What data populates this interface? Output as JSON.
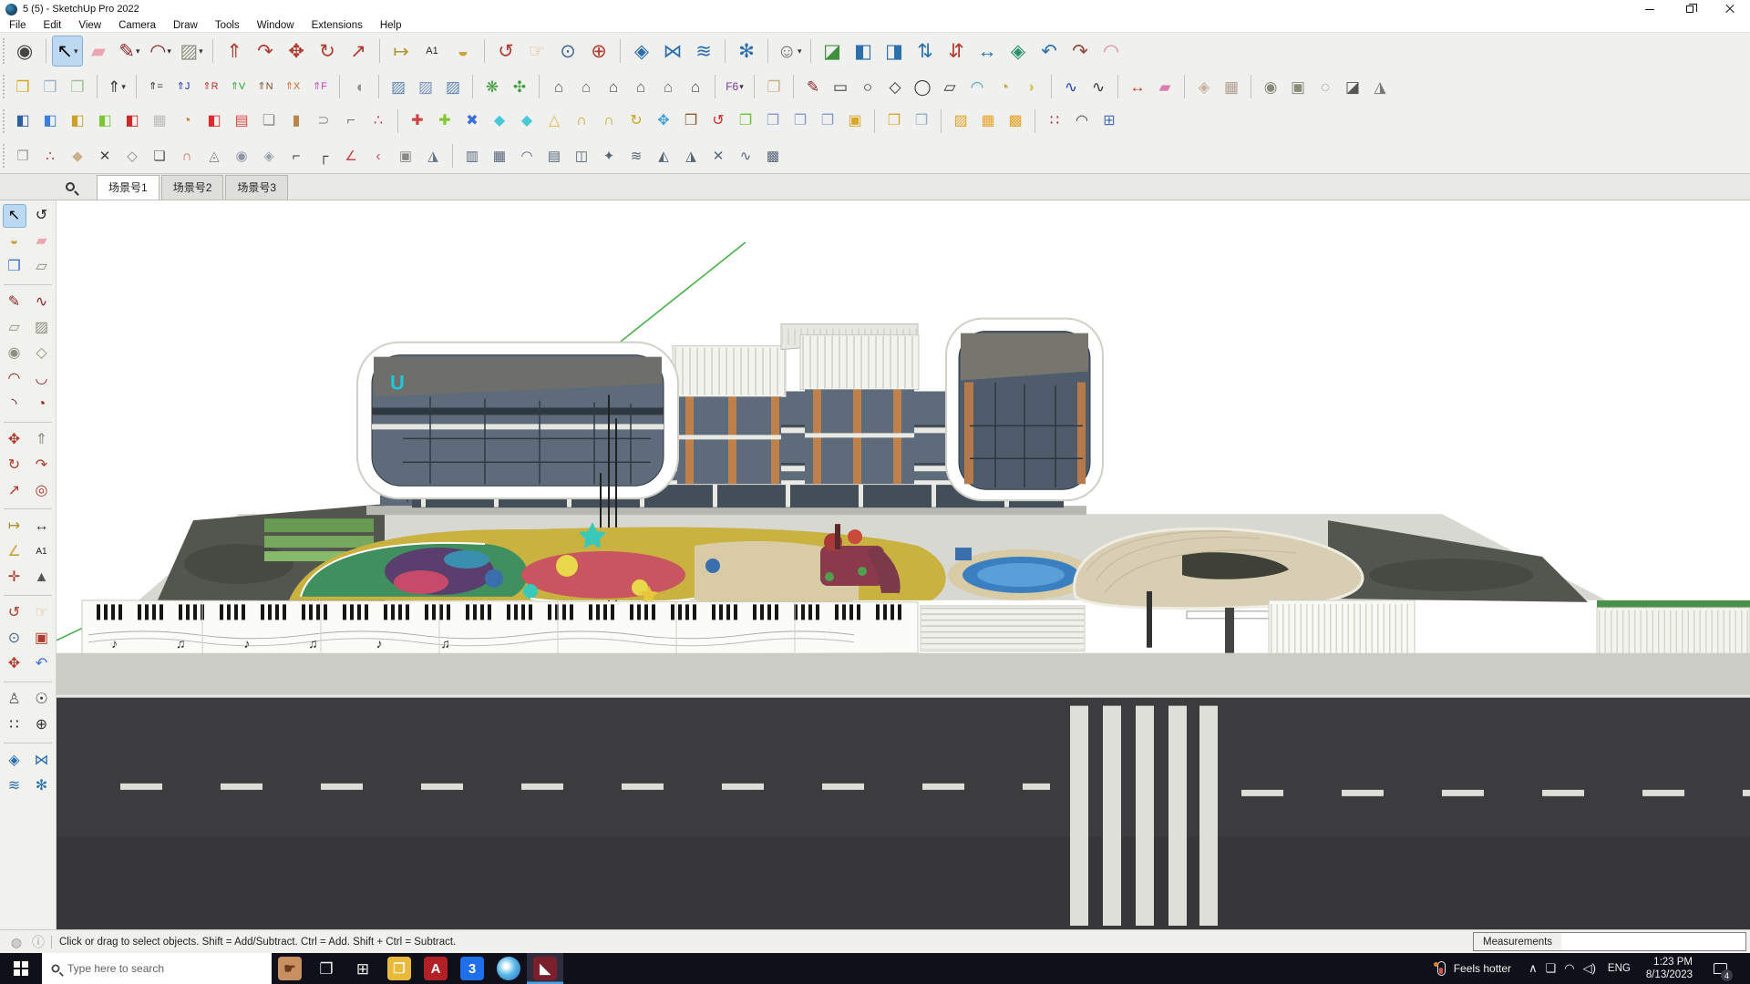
{
  "window": {
    "title": "5 (5) - SketchUp Pro 2022"
  },
  "menu": {
    "items": [
      "File",
      "Edit",
      "View",
      "Camera",
      "Draw",
      "Tools",
      "Window",
      "Extensions",
      "Help"
    ]
  },
  "toolbar_row1": [
    {
      "n": "zoom-selection",
      "g": "◉",
      "c": "#444"
    },
    {
      "sep": true
    },
    {
      "n": "select",
      "g": "↖",
      "c": "#000",
      "active": true,
      "dd": true
    },
    {
      "n": "eraser",
      "g": "▰",
      "c": "#eba6b1"
    },
    {
      "n": "line",
      "g": "✎",
      "c": "#8d2323",
      "dd": true
    },
    {
      "n": "arc",
      "g": "◠",
      "c": "#8d2323",
      "dd": true
    },
    {
      "n": "rectangle",
      "g": "▨",
      "c": "#8f8f7f",
      "dd": true
    },
    {
      "sep": true
    },
    {
      "n": "push-pull",
      "g": "⇑",
      "c": "#b03a2e"
    },
    {
      "n": "follow-me",
      "g": "↷",
      "c": "#b03a2e"
    },
    {
      "n": "move",
      "g": "✥",
      "c": "#b03a2e"
    },
    {
      "n": "rotate",
      "g": "↻",
      "c": "#b03a2e"
    },
    {
      "n": "scale",
      "g": "↗",
      "c": "#b03a2e"
    },
    {
      "sep": true
    },
    {
      "n": "tape-measure",
      "g": "↦",
      "c": "#b0952f"
    },
    {
      "n": "text",
      "g": "A1",
      "c": "#222",
      "fs": 11
    },
    {
      "n": "paint-bucket",
      "g": "◒",
      "c": "#caa23f"
    },
    {
      "sep": true
    },
    {
      "n": "orbit",
      "g": "↺",
      "c": "#b03a2e"
    },
    {
      "n": "pan",
      "g": "☞",
      "c": "#d9b98b"
    },
    {
      "n": "zoom",
      "g": "⊙",
      "c": "#46688e"
    },
    {
      "n": "zoom-extents",
      "g": "⊕",
      "c": "#b03a2e"
    },
    {
      "sep": true
    },
    {
      "n": "solid-inspect",
      "g": "◈",
      "c": "#2c6fad"
    },
    {
      "n": "mirror",
      "g": "⋈",
      "c": "#2c6fad"
    },
    {
      "n": "stack-layers",
      "g": "≋",
      "c": "#2c6fad"
    },
    {
      "sep": true
    },
    {
      "n": "mirror-settings",
      "g": "✻",
      "c": "#2c6fad"
    },
    {
      "sep": true
    },
    {
      "n": "account",
      "g": "☺",
      "c": "#666",
      "dd": true
    },
    {
      "sep": true
    },
    {
      "n": "drop-to-face",
      "g": "◪",
      "c": "#3f8f3f"
    },
    {
      "n": "flatten-face",
      "g": "◧",
      "c": "#2c6fad"
    },
    {
      "n": "split-face",
      "g": "◨",
      "c": "#2c6fad"
    },
    {
      "n": "move-up-down",
      "g": "⇅",
      "c": "#2c6fad"
    },
    {
      "n": "move-down-up",
      "g": "⇵",
      "c": "#b03a2e"
    },
    {
      "n": "stretch-diagonal",
      "g": "↔",
      "c": "#2c6fad"
    },
    {
      "n": "flip-face",
      "g": "◈",
      "c": "#2c8f6f"
    },
    {
      "n": "bend-back",
      "g": "↶",
      "c": "#2c6fad"
    },
    {
      "n": "bend-forward",
      "g": "↷",
      "c": "#8d4a3a"
    },
    {
      "n": "round-corner",
      "g": "◠",
      "c": "#d98ba0"
    }
  ],
  "toolbar_row2": [
    {
      "n": "solid-union",
      "g": "❒",
      "c": "#d9a827"
    },
    {
      "n": "solid-subtract",
      "g": "❒",
      "c": "#9fb4cc"
    },
    {
      "n": "solid-intersect",
      "g": "❒",
      "c": "#9fc49a"
    },
    {
      "sep": true
    },
    {
      "n": "joint-push-pull-main",
      "g": "⇑",
      "c": "#333",
      "dd": true
    },
    {
      "sep": true
    },
    {
      "n": "jpp-equal",
      "g": "⇑=",
      "c": "#222",
      "fs": 11
    },
    {
      "n": "jpp-joint",
      "g": "⇑J",
      "c": "#2233bb",
      "fs": 11
    },
    {
      "n": "jpp-round",
      "g": "⇑R",
      "c": "#bb3333",
      "fs": 11
    },
    {
      "n": "jpp-vector",
      "g": "⇑V",
      "c": "#2f9f2f",
      "fs": 11
    },
    {
      "n": "jpp-normal",
      "g": "⇑N",
      "c": "#7a5230",
      "fs": 11
    },
    {
      "n": "jpp-extrude",
      "g": "⇑X",
      "c": "#d2691e",
      "fs": 11
    },
    {
      "n": "jpp-follow",
      "g": "⇑F",
      "c": "#c03fc0",
      "fs": 11
    },
    {
      "sep": true
    },
    {
      "n": "shell",
      "g": "◖",
      "c": "#8f8f8f"
    },
    {
      "sep": true
    },
    {
      "n": "slice-a",
      "g": "▨",
      "c": "#5b84b1"
    },
    {
      "n": "slice-b",
      "g": "▨",
      "c": "#7b94c1"
    },
    {
      "n": "slice-c",
      "g": "▨",
      "c": "#5b84b1"
    },
    {
      "sep": true
    },
    {
      "n": "terrain-contours",
      "g": "❋",
      "c": "#3f9f3f"
    },
    {
      "n": "terrain-mesh",
      "g": "✣",
      "c": "#3f9f3f"
    },
    {
      "sep": true
    },
    {
      "n": "instant-roof",
      "g": "⌂",
      "c": "#555"
    },
    {
      "n": "instant-wall",
      "g": "⌂",
      "c": "#666"
    },
    {
      "n": "house-builder",
      "g": "⌂",
      "c": "#444"
    },
    {
      "n": "roof-flat",
      "g": "⌂",
      "c": "#555"
    },
    {
      "n": "roof-plain",
      "g": "⌂",
      "c": "#666"
    },
    {
      "n": "roof-hip",
      "g": "⌂",
      "c": "#444"
    },
    {
      "sep": true
    },
    {
      "n": "fredo6-menu",
      "g": "F6",
      "c": "#7a2f9f",
      "fs": 12,
      "dd": true
    },
    {
      "sep": true
    },
    {
      "n": "material-book",
      "g": "❐",
      "c": "#c9b286"
    },
    {
      "sep": true
    },
    {
      "n": "tos-line",
      "g": "✎",
      "c": "#8d2323"
    },
    {
      "n": "tos-rectangle",
      "g": "▭",
      "c": "#333"
    },
    {
      "n": "tos-circle",
      "g": "○",
      "c": "#333"
    },
    {
      "n": "tos-polygon",
      "g": "◇",
      "c": "#333"
    },
    {
      "n": "tos-ellipse",
      "g": "◯",
      "c": "#333"
    },
    {
      "n": "tos-parallelogram",
      "g": "▱",
      "c": "#333"
    },
    {
      "n": "tos-arc",
      "g": "◠",
      "c": "#3a9fc0"
    },
    {
      "n": "tos-circle-mod",
      "g": "◔",
      "c": "#caa23f"
    },
    {
      "n": "tos-pie",
      "g": "◗",
      "c": "#d8c86a"
    },
    {
      "sep": true
    },
    {
      "n": "tos-polyline",
      "g": "∿",
      "c": "#2244aa"
    },
    {
      "n": "tos-freehand",
      "g": "∿",
      "c": "#333"
    },
    {
      "sep": true
    },
    {
      "n": "tos-offset",
      "g": "↔",
      "c": "#c0392b"
    },
    {
      "n": "tos-eraser",
      "g": "▰",
      "c": "#d77fb0"
    },
    {
      "sep": true
    },
    {
      "n": "sandbox-from-contours",
      "g": "◈",
      "c": "#c9b0a0"
    },
    {
      "n": "sandbox-from-scratch",
      "g": "▦",
      "c": "#b0a090"
    },
    {
      "sep": true
    },
    {
      "n": "sandbox-smoove",
      "g": "◉",
      "c": "#8a8a7a"
    },
    {
      "n": "sandbox-stamp",
      "g": "▣",
      "c": "#8a8a7a"
    },
    {
      "n": "sandbox-drape",
      "g": "◌",
      "c": "#8a8a7a"
    },
    {
      "n": "sandbox-add-detail",
      "g": "◪",
      "c": "#555"
    },
    {
      "n": "sandbox-flip-edge",
      "g": "◮",
      "c": "#777"
    }
  ],
  "toolbar_row3": [
    {
      "n": "tile-hash",
      "g": "◧",
      "c": "#2e5fa3"
    },
    {
      "n": "tile-blue",
      "g": "◧",
      "c": "#3a7fd9"
    },
    {
      "n": "tile-gold",
      "g": "◧",
      "c": "#c9a227"
    },
    {
      "n": "tile-green",
      "g": "◧",
      "c": "#7ec832"
    },
    {
      "n": "tile-red",
      "g": "◧",
      "c": "#cc2a2a"
    },
    {
      "n": "tile-white",
      "g": "▦",
      "c": "#bbb"
    },
    {
      "n": "swirl-tool",
      "g": "◔",
      "c": "#c87f2a"
    },
    {
      "n": "red-corner-panel",
      "g": "◧",
      "c": "#dd2a2a"
    },
    {
      "n": "striped-panel",
      "g": "▤",
      "c": "#dd4444"
    },
    {
      "n": "flag-tool",
      "g": "❏",
      "c": "#888"
    },
    {
      "n": "wood-block",
      "g": "▮",
      "c": "#b9854a"
    },
    {
      "n": "pipe-joint",
      "g": "⊃",
      "c": "#999"
    },
    {
      "n": "corner-profile",
      "g": "⌐",
      "c": "#777"
    },
    {
      "n": "point-chain",
      "g": "∴",
      "c": "#cc3344"
    },
    {
      "sep": true
    },
    {
      "n": "cross-red",
      "g": "✚",
      "c": "#cc4444"
    },
    {
      "n": "cross-green",
      "g": "✚",
      "c": "#7ec832"
    },
    {
      "n": "cross-blue",
      "g": "✖",
      "c": "#3a6fd9"
    },
    {
      "n": "waterdrop",
      "g": "◆",
      "c": "#49c8d8"
    },
    {
      "n": "waterdrop-hash",
      "g": "◆",
      "c": "#49c8d8"
    },
    {
      "n": "cone-tool",
      "g": "△",
      "c": "#d9b94a"
    },
    {
      "n": "hoop",
      "g": "∩",
      "c": "#c9a227"
    },
    {
      "n": "hoop-cut",
      "g": "∩",
      "c": "#c9a227"
    },
    {
      "n": "hoop-rotate",
      "g": "↻",
      "c": "#c9a227"
    },
    {
      "n": "move-blue",
      "g": "✥",
      "c": "#3a9fd9"
    },
    {
      "n": "bucket-box",
      "g": "❒",
      "c": "#8a5a2a"
    },
    {
      "n": "undo-red",
      "g": "↺",
      "c": "#cc2a2a"
    },
    {
      "n": "green-boxes",
      "g": "❐",
      "c": "#5fc832"
    },
    {
      "n": "box-copy",
      "g": "❐",
      "c": "#8899cc"
    },
    {
      "n": "box-rotate",
      "g": "❐",
      "c": "#8899cc"
    },
    {
      "n": "box-lift",
      "g": "❐",
      "c": "#8899cc"
    },
    {
      "n": "gold-panel",
      "g": "▣",
      "c": "#d9a827"
    },
    {
      "sep": true
    },
    {
      "n": "cube-pair",
      "g": "❒",
      "c": "#d9a827"
    },
    {
      "n": "cube-wireframe",
      "g": "❐",
      "c": "#9ab0c8"
    },
    {
      "sep": true
    },
    {
      "n": "hatch-diagonal",
      "g": "▨",
      "c": "#e8a227"
    },
    {
      "n": "hatch-cross",
      "g": "▦",
      "c": "#e8a227"
    },
    {
      "n": "hatch-grid",
      "g": "▩",
      "c": "#e8a227"
    },
    {
      "sep": true
    },
    {
      "n": "points-scatter",
      "g": "∷",
      "c": "#aa2222"
    },
    {
      "n": "arc-points",
      "g": "◠",
      "c": "#444"
    },
    {
      "n": "boxes-mark",
      "g": "⊞",
      "c": "#4a6fae"
    }
  ],
  "toolbar_row4": [
    {
      "n": "surface-sketch",
      "g": "❐",
      "c": "#999"
    },
    {
      "n": "curve-points",
      "g": "∴",
      "c": "#b03a2e"
    },
    {
      "n": "fold-face",
      "g": "◆",
      "c": "#c9b08a"
    },
    {
      "n": "axis-cross",
      "g": "✕",
      "c": "#444"
    },
    {
      "n": "dashed-polygon",
      "g": "◇",
      "c": "#888"
    },
    {
      "n": "outline-shape",
      "g": "❏",
      "c": "#555"
    },
    {
      "n": "curved-tube",
      "g": "∩",
      "c": "#c06a5a"
    },
    {
      "n": "taper-box",
      "g": "◬",
      "c": "#888"
    },
    {
      "n": "sphere-cut",
      "g": "◉",
      "c": "#8a93a8"
    },
    {
      "n": "gem-face",
      "g": "◈",
      "c": "#99a3b0"
    },
    {
      "n": "corner-round",
      "g": "⌐",
      "c": "#333"
    },
    {
      "n": "corner-fillet",
      "g": "┌",
      "c": "#333"
    },
    {
      "n": "angle-tool",
      "g": "∠",
      "c": "#cc4444"
    },
    {
      "n": "curve-offset",
      "g": "‹",
      "c": "#cc4444"
    },
    {
      "n": "frame-box",
      "g": "▣",
      "c": "#888"
    },
    {
      "n": "prism-lines",
      "g": "◮",
      "c": "#667788"
    },
    {
      "sep": true
    },
    {
      "n": "bars-chart",
      "g": "▥",
      "c": "#556677"
    },
    {
      "n": "grid-mesh",
      "g": "▦",
      "c": "#556677"
    },
    {
      "n": "arc-profile",
      "g": "◠",
      "c": "#556677"
    },
    {
      "n": "panel-lines",
      "g": "▤",
      "c": "#556677"
    },
    {
      "n": "window-split",
      "g": "◫",
      "c": "#556677"
    },
    {
      "n": "spark-point",
      "g": "✦",
      "c": "#556677"
    },
    {
      "n": "wave-lines",
      "g": "≋",
      "c": "#556677"
    },
    {
      "n": "tri-left",
      "g": "◭",
      "c": "#556677"
    },
    {
      "n": "tri-right",
      "g": "◮",
      "c": "#556677"
    },
    {
      "n": "cross-mark",
      "g": "✕",
      "c": "#556677"
    },
    {
      "n": "squiggle",
      "g": "∿",
      "c": "#556677"
    },
    {
      "n": "dense-grid",
      "g": "▩",
      "c": "#556677"
    }
  ],
  "palette": [
    {
      "n": "select",
      "g": "↖",
      "c": "#000",
      "active": true
    },
    {
      "n": "lasso-select",
      "g": "↺",
      "c": "#222"
    },
    {
      "n": "paint-bucket",
      "g": "◒",
      "c": "#caa23f"
    },
    {
      "n": "eraser",
      "g": "▰",
      "c": "#eba6b1"
    },
    {
      "n": "component",
      "g": "❒",
      "c": "#3a6fd9"
    },
    {
      "n": "tag",
      "g": "▱",
      "c": "#8a8a7a"
    },
    {
      "sep": true
    },
    {
      "n": "line",
      "g": "✎",
      "c": "#8d2323"
    },
    {
      "n": "freehand",
      "g": "∿",
      "c": "#8d2323"
    },
    {
      "n": "rectangle",
      "g": "▱",
      "c": "#8f8f7f"
    },
    {
      "n": "rotated-rectangle",
      "g": "▨",
      "c": "#8f8f7f"
    },
    {
      "n": "circle",
      "g": "◉",
      "c": "#8f8f7f"
    },
    {
      "n": "polygon",
      "g": "◇",
      "c": "#8f8f7f"
    },
    {
      "n": "arc",
      "g": "◠",
      "c": "#8d2323"
    },
    {
      "n": "two-point-arc",
      "g": "◡",
      "c": "#8d2323"
    },
    {
      "n": "three-point-arc",
      "g": "◝",
      "c": "#8d2323"
    },
    {
      "n": "pie",
      "g": "◔",
      "c": "#8d2323"
    },
    {
      "sep": true
    },
    {
      "n": "move",
      "g": "✥",
      "c": "#b03a2e"
    },
    {
      "n": "push-pull",
      "g": "⇑",
      "c": "#8a8a7a"
    },
    {
      "n": "rotate",
      "g": "↻",
      "c": "#b03a2e"
    },
    {
      "n": "follow-me",
      "g": "↷",
      "c": "#b03a2e"
    },
    {
      "n": "scale",
      "g": "↗",
      "c": "#b03a2e"
    },
    {
      "n": "offset",
      "g": "◎",
      "c": "#b03a2e"
    },
    {
      "sep": true
    },
    {
      "n": "tape-measure",
      "g": "↦",
      "c": "#b0952f"
    },
    {
      "n": "dimensions",
      "g": "↔",
      "c": "#333"
    },
    {
      "n": "protractor",
      "g": "∠",
      "c": "#caa23f"
    },
    {
      "n": "text",
      "g": "A1",
      "c": "#222",
      "fs": 10
    },
    {
      "n": "axes",
      "g": "✛",
      "c": "#b03a2e"
    },
    {
      "n": "three-d-text",
      "g": "▲",
      "c": "#555"
    },
    {
      "sep": true
    },
    {
      "n": "orbit",
      "g": "↺",
      "c": "#b03a2e"
    },
    {
      "n": "pan",
      "g": "☞",
      "c": "#d9b98b"
    },
    {
      "n": "zoom",
      "g": "⊙",
      "c": "#46688e"
    },
    {
      "n": "zoom-window",
      "g": "▣",
      "c": "#b03a2e"
    },
    {
      "n": "zoom-extents",
      "g": "✥",
      "c": "#b03a2e"
    },
    {
      "n": "previous-view",
      "g": "↶",
      "c": "#3a6fd9"
    },
    {
      "sep": true
    },
    {
      "n": "position-camera",
      "g": "♙",
      "c": "#555"
    },
    {
      "n": "look-around",
      "g": "☉",
      "c": "#333"
    },
    {
      "n": "walk",
      "g": "∷",
      "c": "#222"
    },
    {
      "n": "turn-compass",
      "g": "⊕",
      "c": "#333"
    },
    {
      "sep": true
    },
    {
      "n": "curic-deep-select",
      "g": "◈",
      "c": "#2c6fad"
    },
    {
      "n": "curic-mirror",
      "g": "⋈",
      "c": "#2c6fad"
    },
    {
      "n": "curic-stack",
      "g": "≋",
      "c": "#2c6fad"
    },
    {
      "n": "curic-settings",
      "g": "✻",
      "c": "#2c6fad"
    }
  ],
  "scene_tabs": {
    "tabs": [
      {
        "label": "场景号1",
        "active": true
      },
      {
        "label": "场景号2",
        "active": false
      },
      {
        "label": "场景号3",
        "active": false
      }
    ]
  },
  "viewport": {
    "logo_text": "U",
    "music_notes": "♪    ♫     ♪     ♫     ♪     ♫"
  },
  "status_bar": {
    "icons": [
      {
        "n": "geolocation-status",
        "g": "◍",
        "c": "#999"
      },
      {
        "n": "credits-info",
        "g": "ⓘ",
        "c": "#999"
      }
    ],
    "hint": "Click or drag to select objects. Shift = Add/Subtract. Ctrl = Add. Shift + Ctrl = Subtract.",
    "measurements_label": "Measurements"
  },
  "taskbar": {
    "search_placeholder": "Type here to search",
    "apps": [
      {
        "n": "pinned-thumbnail",
        "bg": "#c89060",
        "t": "☛",
        "tc": "#6a3a1a"
      },
      {
        "n": "task-view",
        "g": "❐",
        "c": "#eee"
      },
      {
        "n": "app-grid",
        "g": "⊞",
        "c": "#eee"
      },
      {
        "n": "file-explorer",
        "bg": "#e8b93a",
        "t": "❒",
        "tc": "#fdf3d0"
      },
      {
        "n": "acrobat",
        "bg": "#b02024",
        "t": "A",
        "tc": "#fff"
      },
      {
        "n": "app-3",
        "bg": "#1f6feb",
        "t": "3",
        "tc": "#fff"
      },
      {
        "n": "browser",
        "cls": "browser-orb",
        "bg": "#2b68b8",
        "t": "",
        "tc": "#fff"
      },
      {
        "n": "sketchup",
        "bg": "#7a1f2b",
        "t": "◣",
        "tc": "#fff",
        "active": true
      }
    ],
    "weather": "Feels hotter",
    "language": "ENG",
    "time": "1:23 PM",
    "date": "8/13/2023",
    "notification_count": "4"
  }
}
